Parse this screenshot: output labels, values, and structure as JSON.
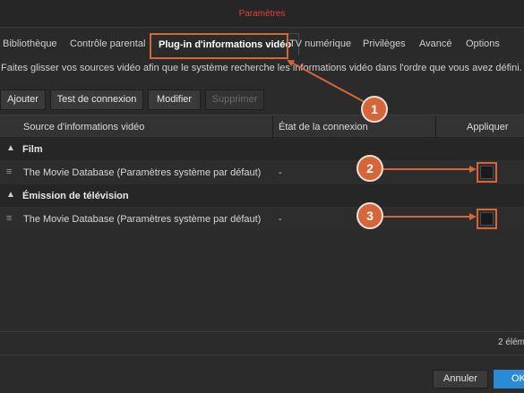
{
  "window": {
    "title": "Paramètres"
  },
  "tabs": [
    {
      "label": "Bibliothèque"
    },
    {
      "label": "Contrôle parental"
    },
    {
      "label": "Plug-in d'informations vidéo"
    },
    {
      "label": "TV numérique"
    },
    {
      "label": "Privilèges"
    },
    {
      "label": "Avancé"
    },
    {
      "label": "Options"
    }
  ],
  "active_tab": "Plug-in d'informations vidéo",
  "description": "Faites glisser vos sources vidéo afin que le système recherche les informations vidéo dans l'ordre que vous avez défini.",
  "toolbar": {
    "add": "Ajouter",
    "test": "Test de connexion",
    "edit": "Modifier",
    "delete": "Supprimer"
  },
  "columns": {
    "source": "Source d'informations vidéo",
    "state": "État de la connexion",
    "apply": "Appliquer"
  },
  "groups": [
    {
      "label": "Film",
      "rows": [
        {
          "source": "The Movie Database (Paramètres système par défaut)",
          "state": "-",
          "apply": false
        }
      ]
    },
    {
      "label": "Émission de télévision",
      "rows": [
        {
          "source": "The Movie Database (Paramètres système par défaut)",
          "state": "-",
          "apply": false
        }
      ]
    }
  ],
  "footer": {
    "count": "2 élém"
  },
  "buttons": {
    "cancel": "Annuler",
    "ok": "OK"
  },
  "annotations": [
    "1",
    "2",
    "3"
  ],
  "colors": {
    "accent_orange": "#d4663a",
    "title_red": "#e0413f",
    "ok_blue": "#2b8ad6"
  },
  "icons": {
    "group_toggle": "chevron-up-icon",
    "drag": "drag-handle-icon"
  }
}
